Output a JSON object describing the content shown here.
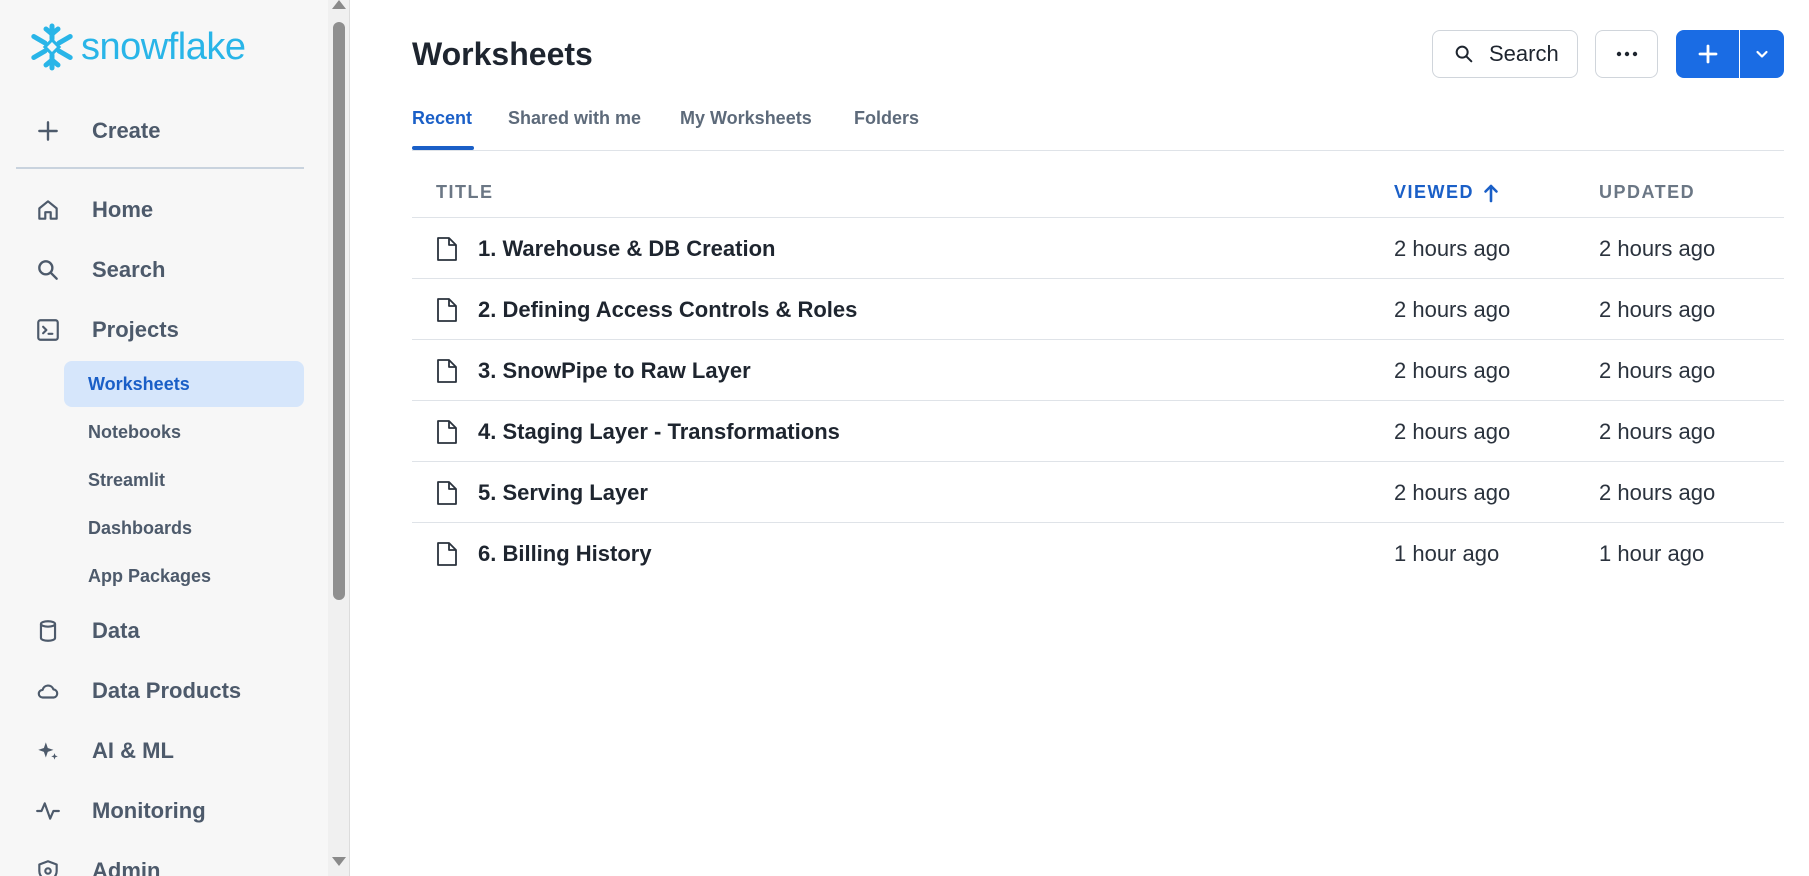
{
  "brand": {
    "name": "snowflake",
    "color": "#29b5e8"
  },
  "sidebar": {
    "create_label": "Create",
    "items": [
      {
        "label": "Home",
        "icon": "home-icon"
      },
      {
        "label": "Search",
        "icon": "search-icon"
      },
      {
        "label": "Projects",
        "icon": "terminal-icon"
      },
      {
        "label": "Data",
        "icon": "database-icon"
      },
      {
        "label": "Data Products",
        "icon": "cloud-icon"
      },
      {
        "label": "AI & ML",
        "icon": "sparkle-icon"
      },
      {
        "label": "Monitoring",
        "icon": "activity-icon"
      },
      {
        "label": "Admin",
        "icon": "shield-icon"
      }
    ],
    "project_sub_items": [
      {
        "label": "Worksheets",
        "active": true
      },
      {
        "label": "Notebooks",
        "active": false
      },
      {
        "label": "Streamlit",
        "active": false
      },
      {
        "label": "Dashboards",
        "active": false
      },
      {
        "label": "App Packages",
        "active": false
      }
    ]
  },
  "header": {
    "title": "Worksheets",
    "search_label": "Search",
    "accent_color": "#1a6ce4"
  },
  "tabs": [
    {
      "label": "Recent",
      "active": true
    },
    {
      "label": "Shared with me",
      "active": false
    },
    {
      "label": "My Worksheets",
      "active": false
    },
    {
      "label": "Folders",
      "active": false
    }
  ],
  "table": {
    "columns": [
      {
        "label": "TITLE",
        "sorted": false
      },
      {
        "label": "VIEWED",
        "sorted": true,
        "sort_direction": "ascending"
      },
      {
        "label": "UPDATED",
        "sorted": false
      }
    ],
    "rows": [
      {
        "title": "1. Warehouse & DB Creation",
        "viewed": "2 hours ago",
        "updated": "2 hours ago"
      },
      {
        "title": "2. Defining Access Controls & Roles",
        "viewed": "2 hours ago",
        "updated": "2 hours ago"
      },
      {
        "title": "3. SnowPipe to Raw Layer",
        "viewed": "2 hours ago",
        "updated": "2 hours ago"
      },
      {
        "title": "4. Staging Layer - Transformations",
        "viewed": "2 hours ago",
        "updated": "2 hours ago"
      },
      {
        "title": "5. Serving Layer",
        "viewed": "2 hours ago",
        "updated": "2 hours ago"
      },
      {
        "title": "6. Billing History",
        "viewed": "1 hour ago",
        "updated": "1 hour ago"
      }
    ]
  }
}
